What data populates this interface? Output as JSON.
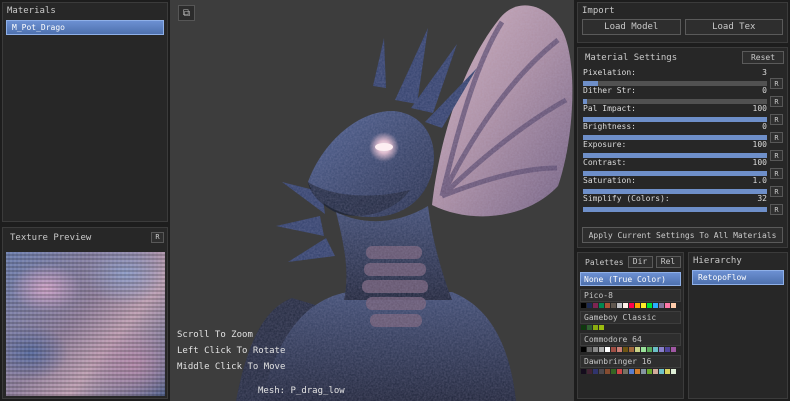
{
  "colors": {
    "accent": "#5e82c6",
    "slider_fill": "#6e8fc9",
    "viewport_bg": "#3d3d3d"
  },
  "materials_panel": {
    "title": "Materials",
    "items": [
      {
        "label": "M_Pot_Drago",
        "selected": true
      }
    ]
  },
  "texture_preview": {
    "title": "Texture Preview",
    "reset_label": "R"
  },
  "viewport": {
    "hints": [
      "Scroll To Zoom",
      "Left Click To Rotate",
      "Middle Click To Move"
    ],
    "mesh_label": "Mesh: P_drag_low"
  },
  "viewport_toolbar": {
    "flip_icon": "⧉"
  },
  "import_panel": {
    "title": "Import",
    "load_model_label": "Load Model",
    "load_tex_label": "Load Tex"
  },
  "material_settings": {
    "title": "Material Settings",
    "reset_label": "Reset",
    "r_label": "R",
    "apply_label": "Apply Current Settings To All Materials",
    "sliders": [
      {
        "label": "Pixelation:",
        "value": "3",
        "fill_pct": 8
      },
      {
        "label": "Dither Str:",
        "value": "0",
        "fill_pct": 2
      },
      {
        "label": "Pal Impact:",
        "value": "100",
        "fill_pct": 100
      },
      {
        "label": "Brightness:",
        "value": "0",
        "fill_pct": 100
      },
      {
        "label": "Exposure:",
        "value": "100",
        "fill_pct": 100
      },
      {
        "label": "Contrast:",
        "value": "100",
        "fill_pct": 100
      },
      {
        "label": "Saturation:",
        "value": "1.0",
        "fill_pct": 100
      },
      {
        "label": "Simplify (Colors):",
        "value": "32",
        "fill_pct": 100
      }
    ]
  },
  "palettes_panel": {
    "title": "Palettes",
    "dir_label": "Dir",
    "rel_label": "Rel",
    "items": [
      {
        "label": "None (True Color)",
        "selected": true,
        "swatches": []
      },
      {
        "label": "Pico-8",
        "selected": false,
        "swatches": [
          "#000000",
          "#1d2b53",
          "#7e2553",
          "#008751",
          "#ab5236",
          "#5f574f",
          "#c2c3c7",
          "#fff1e8",
          "#ff004d",
          "#ffa300",
          "#ffec27",
          "#00e436",
          "#29adff",
          "#83769c",
          "#ff77a8",
          "#ffccaa"
        ]
      },
      {
        "label": "Gameboy Classic",
        "selected": false,
        "swatches": [
          "#0f380f",
          "#306230",
          "#8bac0f",
          "#9bbc0f"
        ]
      },
      {
        "label": "Commodore 64",
        "selected": false,
        "swatches": [
          "#000000",
          "#626262",
          "#898989",
          "#adadad",
          "#ffffff",
          "#9f4e44",
          "#cb7e75",
          "#6d5412",
          "#a1683c",
          "#c9d487",
          "#9ae29b",
          "#5cab5e",
          "#6abfc6",
          "#887ecb",
          "#50459b",
          "#a057a3"
        ]
      },
      {
        "label": "Dawnbringer 16",
        "selected": false,
        "swatches": [
          "#140c1c",
          "#442434",
          "#30346d",
          "#4e4a4e",
          "#854c30",
          "#346524",
          "#d04648",
          "#757161",
          "#597dce",
          "#d27d2c",
          "#8595a1",
          "#6daa2c",
          "#d2aa99",
          "#6dc2ca",
          "#dad45e",
          "#deeed6"
        ]
      }
    ]
  },
  "hierarchy_panel": {
    "title": "Hierarchy",
    "items": [
      {
        "label": "RetopoFlow",
        "selected": true
      }
    ]
  }
}
